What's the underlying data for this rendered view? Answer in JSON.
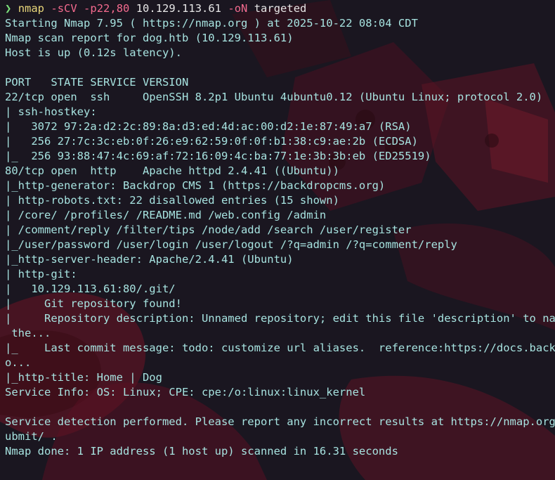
{
  "colors": {
    "background": "#1a1620",
    "output_text": "#a7e3e0",
    "prompt_arrow": "#7be07b",
    "command": "#e8d67a",
    "flag": "#f36a8e",
    "argument": "#e6e6e6",
    "wallpaper_red": "#6e1424"
  },
  "prompt": {
    "symbol": "❯",
    "command": "nmap",
    "flag1": "-sCV",
    "flag2": "-p22,80",
    "target": "10.129.113.61",
    "flag3": "-oN",
    "outfile": "targeted"
  },
  "output": [
    "Starting Nmap 7.95 ( https://nmap.org ) at 2025-10-22 08:04 CDT",
    "Nmap scan report for dog.htb (10.129.113.61)",
    "Host is up (0.12s latency).",
    "",
    "PORT   STATE SERVICE VERSION",
    "22/tcp open  ssh     OpenSSH 8.2p1 Ubuntu 4ubuntu0.12 (Ubuntu Linux; protocol 2.0)",
    "| ssh-hostkey:",
    "|   3072 97:2a:d2:2c:89:8a:d3:ed:4d:ac:00:d2:1e:87:49:a7 (RSA)",
    "|   256 27:7c:3c:eb:0f:26:e9:62:59:0f:0f:b1:38:c9:ae:2b (ECDSA)",
    "|_  256 93:88:47:4c:69:af:72:16:09:4c:ba:77:1e:3b:3b:eb (ED25519)",
    "80/tcp open  http    Apache httpd 2.4.41 ((Ubuntu))",
    "|_http-generator: Backdrop CMS 1 (https://backdropcms.org)",
    "| http-robots.txt: 22 disallowed entries (15 shown)",
    "| /core/ /profiles/ /README.md /web.config /admin",
    "| /comment/reply /filter/tips /node/add /search /user/register",
    "|_/user/password /user/login /user/logout /?q=admin /?q=comment/reply",
    "|_http-server-header: Apache/2.4.41 (Ubuntu)",
    "| http-git:",
    "|   10.129.113.61:80/.git/",
    "|     Git repository found!",
    "|     Repository description: Unnamed repository; edit this file 'description' to name",
    " the...",
    "|_    Last commit message: todo: customize url aliases.  reference:https://docs.backdr",
    "o...",
    "|_http-title: Home | Dog",
    "Service Info: OS: Linux; CPE: cpe:/o:linux:linux_kernel",
    "",
    "Service detection performed. Please report any incorrect results at https://nmap.org/s",
    "ubmit/ .",
    "Nmap done: 1 IP address (1 host up) scanned in 16.31 seconds"
  ]
}
